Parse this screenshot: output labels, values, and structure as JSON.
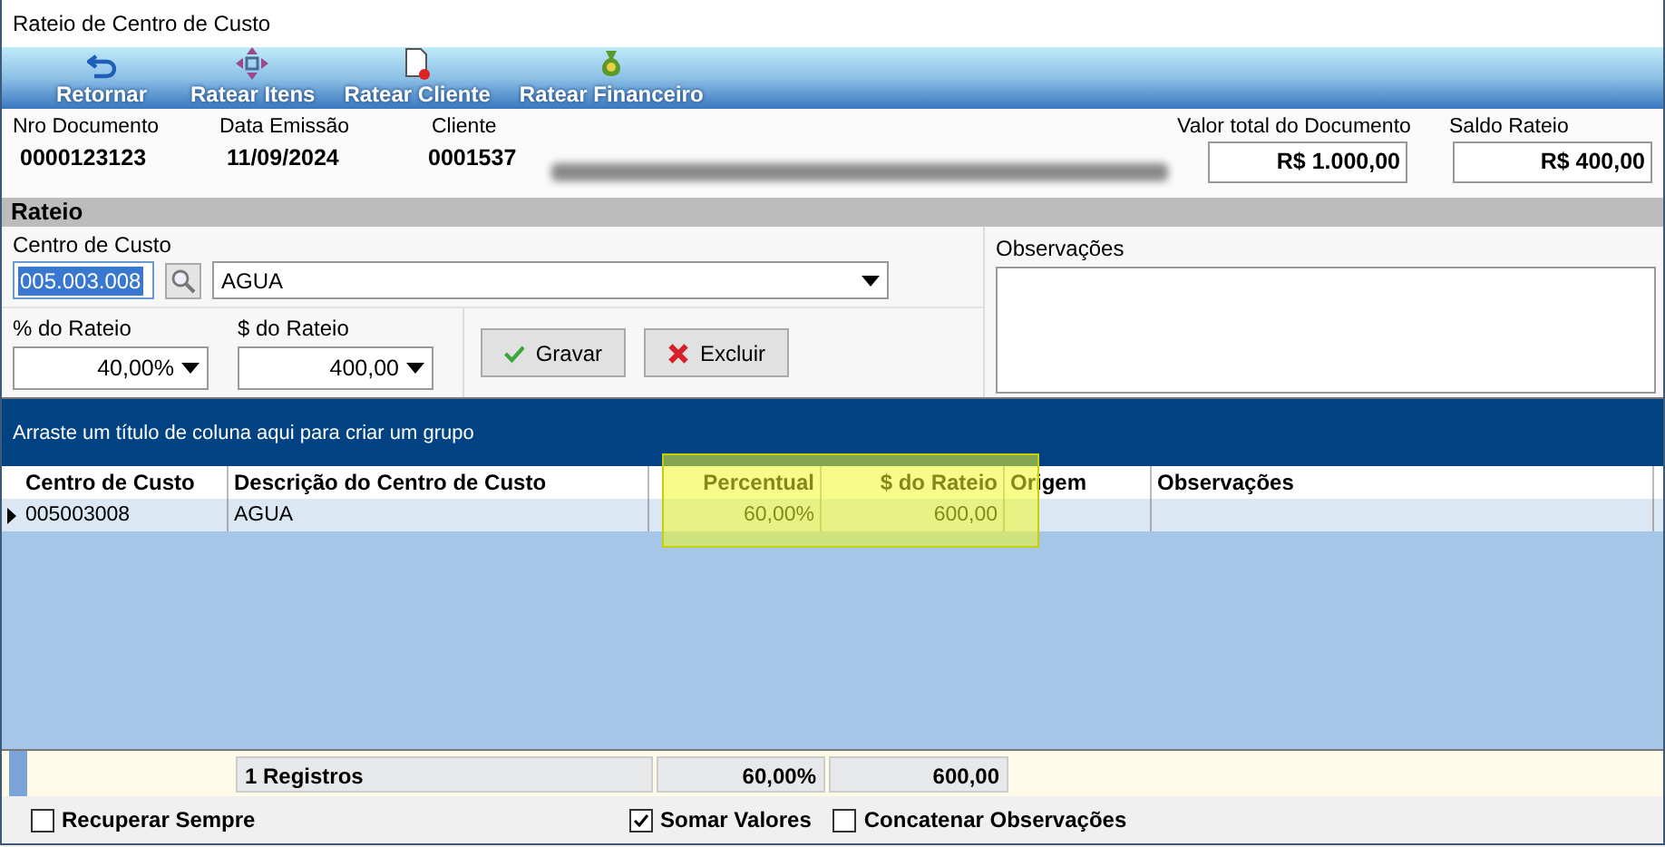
{
  "window": {
    "title": "Rateio de Centro de Custo"
  },
  "toolbar": [
    {
      "label": "Retornar"
    },
    {
      "label": "Ratear Itens"
    },
    {
      "label": "Ratear Cliente"
    },
    {
      "label": "Ratear Financeiro"
    }
  ],
  "header": {
    "doc_label": "Nro Documento",
    "doc_value": "0000123123",
    "date_label": "Data Emissão",
    "date_value": "11/09/2024",
    "client_label": "Cliente",
    "client_code": "0001537",
    "total_label": "Valor total do Documento",
    "total_value": "R$ 1.000,00",
    "saldo_label": "Saldo Rateio",
    "saldo_value": "R$ 400,00"
  },
  "rateio": {
    "title": "Rateio",
    "cc_label": "Centro de Custo",
    "cc_code": "005.003.008",
    "cc_name": "AGUA",
    "pct_label": "% do Rateio",
    "pct_value": "40,00%",
    "val_label": "$ do Rateio",
    "val_value": "400,00",
    "obs_label": "Observações",
    "buttons": [
      {
        "label": "Gravar"
      },
      {
        "label": "Excluir"
      }
    ]
  },
  "grid": {
    "group_hint": "Arraste um título de coluna aqui para criar um grupo",
    "columns": [
      {
        "label": "Centro de Custo",
        "highlighted": false
      },
      {
        "label": "Descrição do Centro de Custo",
        "highlighted": false
      },
      {
        "label": "Percentual",
        "highlighted": true
      },
      {
        "label": "$ do Rateio",
        "highlighted": true
      },
      {
        "label": "Origem",
        "highlighted": false
      },
      {
        "label": "Observações",
        "highlighted": false
      }
    ],
    "rows": [
      {
        "cells": [
          "005003008",
          "AGUA",
          "60,00%",
          "600,00"
        ],
        "selected": true
      }
    ],
    "footer": {
      "count": "1 Registros",
      "percent": "60,00%",
      "amount": "600,00"
    }
  },
  "options": [
    {
      "label": "Recuperar Sempre",
      "checked": false
    },
    {
      "label": "Somar Valores",
      "checked": true
    },
    {
      "label": "Concatenar Observações",
      "checked": false
    }
  ]
}
